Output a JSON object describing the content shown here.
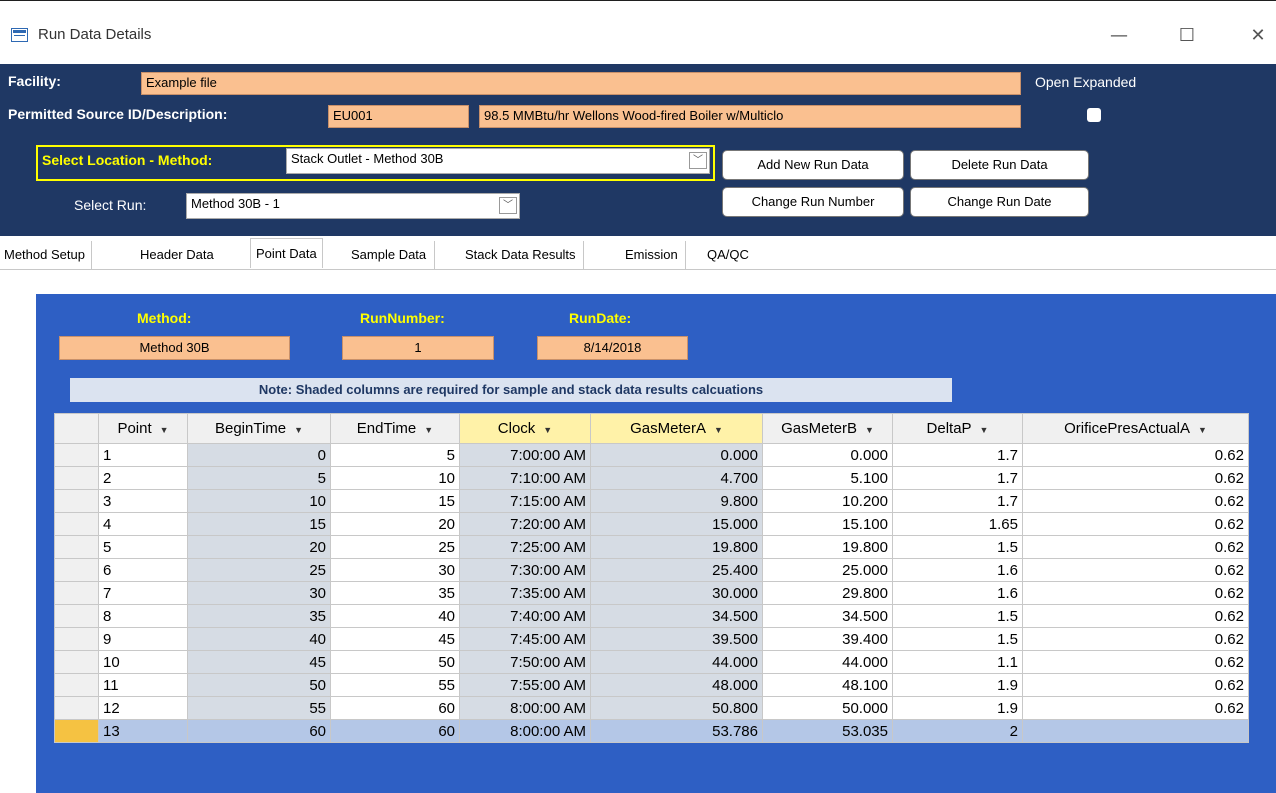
{
  "window": {
    "title": "Run Data Details",
    "minimize": "—",
    "maximize": "☐",
    "close": "✕"
  },
  "header": {
    "facility_label": "Facility:",
    "facility_value": "Example file",
    "source_label": "Permitted Source ID/Description:",
    "source_id": "EU001",
    "source_desc": "98.5 MMBtu/hr Wellons Wood-fired Boiler w/Multiclo",
    "open_expanded_label": "Open Expanded",
    "location_label": "Select Location - Method:",
    "location_value": "Stack Outlet - Method 30B",
    "run_label": "Select Run:",
    "run_value": "Method 30B - 1",
    "btn_add": "Add New Run Data",
    "btn_delete": "Delete Run Data",
    "btn_change_number": "Change Run Number",
    "btn_change_date": "Change Run Date"
  },
  "tabs": [
    "Method Setup",
    "Header Data",
    "Point Data",
    "Sample Data",
    "Stack Data Results",
    "Emission",
    "QA/QC"
  ],
  "active_tab": "Point Data",
  "panel": {
    "method_label": "Method:",
    "method_value": "Method 30B",
    "runnumber_label": "RunNumber:",
    "runnumber_value": "1",
    "rundate_label": "RunDate:",
    "rundate_value": "8/14/2018",
    "note": "Note:  Shaded columns are required for sample and stack data results calcuations"
  },
  "grid": {
    "columns": [
      "Point",
      "BeginTime",
      "EndTime",
      "Clock",
      "GasMeterA",
      "GasMeterB",
      "DeltaP",
      "OrificePresActualA"
    ],
    "rows": [
      [
        "1",
        "0",
        "5",
        "7:00:00 AM",
        "0.000",
        "0.000",
        "1.7",
        "0.62"
      ],
      [
        "2",
        "5",
        "10",
        "7:10:00 AM",
        "4.700",
        "5.100",
        "1.7",
        "0.62"
      ],
      [
        "3",
        "10",
        "15",
        "7:15:00 AM",
        "9.800",
        "10.200",
        "1.7",
        "0.62"
      ],
      [
        "4",
        "15",
        "20",
        "7:20:00 AM",
        "15.000",
        "15.100",
        "1.65",
        "0.62"
      ],
      [
        "5",
        "20",
        "25",
        "7:25:00 AM",
        "19.800",
        "19.800",
        "1.5",
        "0.62"
      ],
      [
        "6",
        "25",
        "30",
        "7:30:00 AM",
        "25.400",
        "25.000",
        "1.6",
        "0.62"
      ],
      [
        "7",
        "30",
        "35",
        "7:35:00 AM",
        "30.000",
        "29.800",
        "1.6",
        "0.62"
      ],
      [
        "8",
        "35",
        "40",
        "7:40:00 AM",
        "34.500",
        "34.500",
        "1.5",
        "0.62"
      ],
      [
        "9",
        "40",
        "45",
        "7:45:00 AM",
        "39.500",
        "39.400",
        "1.5",
        "0.62"
      ],
      [
        "10",
        "45",
        "50",
        "7:50:00 AM",
        "44.000",
        "44.000",
        "1.1",
        "0.62"
      ],
      [
        "11",
        "50",
        "55",
        "7:55:00 AM",
        "48.000",
        "48.100",
        "1.9",
        "0.62"
      ],
      [
        "12",
        "55",
        "60",
        "8:00:00 AM",
        "50.800",
        "50.000",
        "1.9",
        "0.62"
      ],
      [
        "13",
        "60",
        "60",
        "8:00:00 AM",
        "53.786",
        "53.035",
        "2",
        ""
      ]
    ]
  }
}
